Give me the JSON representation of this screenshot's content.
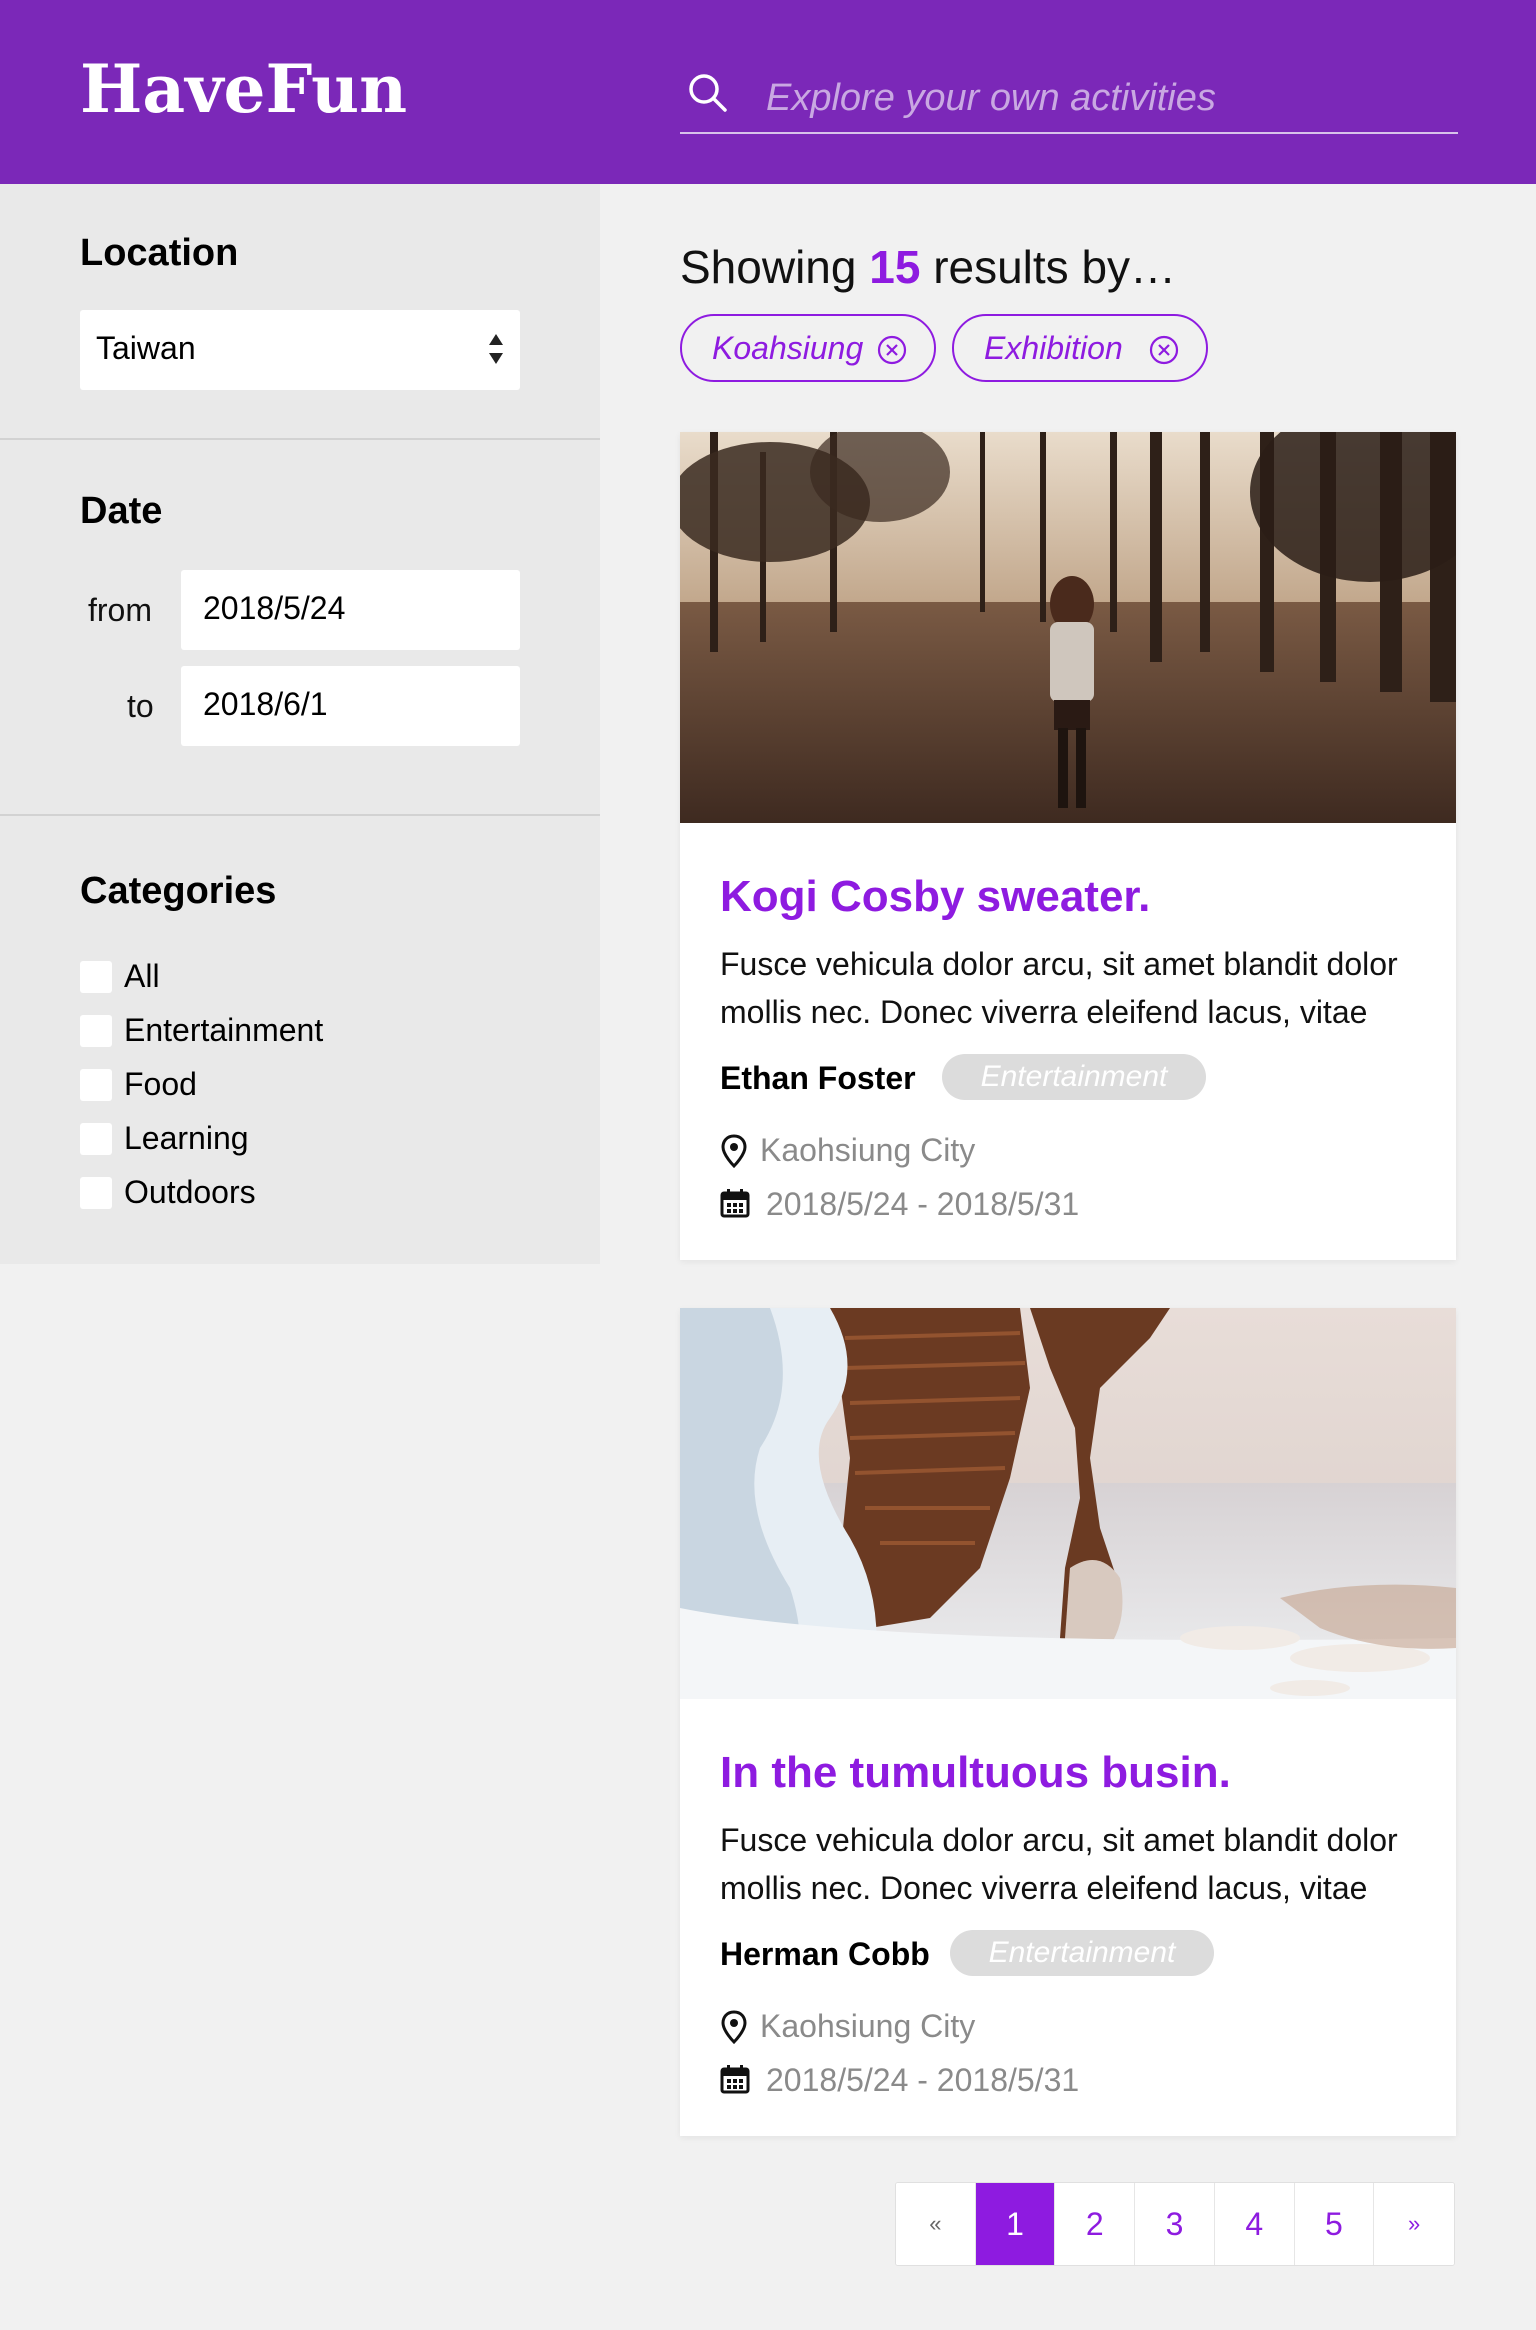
{
  "header": {
    "logo": "HaveFun",
    "search_placeholder": "Explore your own activities",
    "background": "#7b28b8"
  },
  "sidebar": {
    "location": {
      "title": "Location",
      "selected": "Taiwan"
    },
    "date": {
      "title": "Date",
      "from_label": "from",
      "from_value": "2018/5/24",
      "to_label": "to",
      "to_value": "2018/6/1"
    },
    "categories": {
      "title": "Categories",
      "items": [
        "All",
        "Entertainment",
        "Food",
        "Learning",
        "Outdoors"
      ]
    }
  },
  "results": {
    "prefix": "Showing",
    "count": "15",
    "suffix": "results by…",
    "filters": [
      "Koahsiung",
      "Exhibition"
    ]
  },
  "cards": [
    {
      "title": "Kogi Cosby sweater.",
      "description": "Fusce vehicula dolor arcu, sit amet blandit dolor mollis nec. Donec viverra eleifend lacus, vitae",
      "author": "Ethan Foster",
      "tag": "Entertainment",
      "location": "Kaohsiung City",
      "dates": "2018/5/24 - 2018/5/31"
    },
    {
      "title": "In the tumultuous busin.",
      "description": "Fusce vehicula dolor arcu, sit amet blandit dolor mollis nec. Donec viverra eleifend lacus, vitae",
      "author": "Herman Cobb",
      "tag": "Entertainment",
      "location": "Kaohsiung City",
      "dates": "2018/5/24 - 2018/5/31"
    }
  ],
  "pagination": {
    "prev": "«",
    "pages": [
      "1",
      "2",
      "3",
      "4",
      "5"
    ],
    "next": "»",
    "active": "1"
  },
  "colors": {
    "accent": "#8e1be0",
    "header": "#7b28b8",
    "sidebar": "#e9e9e9",
    "background": "#f1f1f1"
  }
}
